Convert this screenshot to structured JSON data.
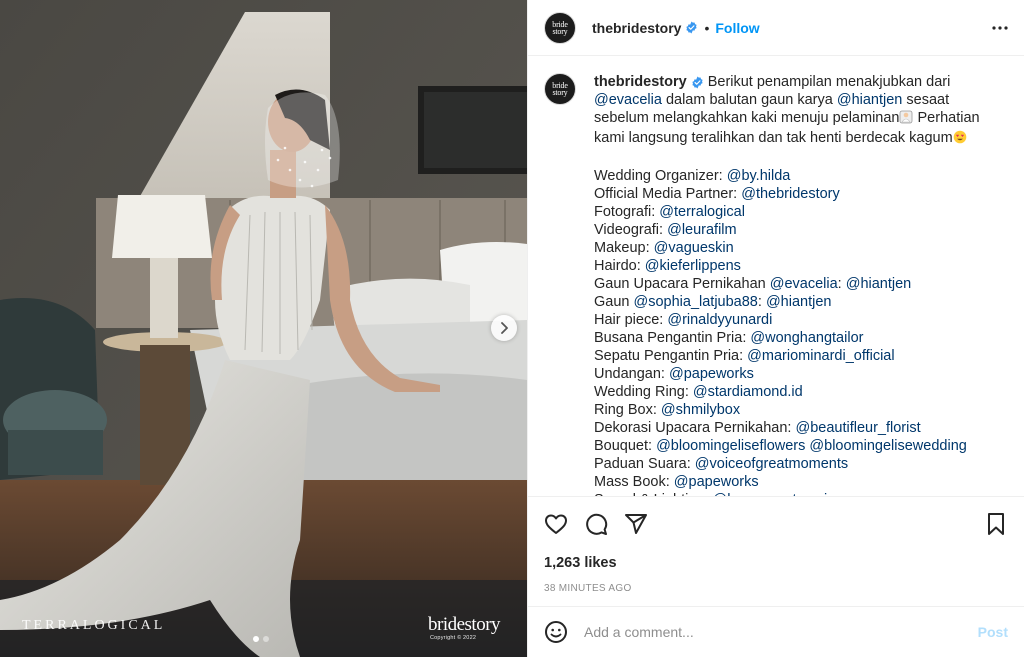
{
  "post": {
    "username": "thebridestory",
    "avatar_text": [
      "bride",
      "story"
    ],
    "follow_label": "Follow",
    "separator": "•"
  },
  "media": {
    "watermark_left": "TERRALOGICAL",
    "watermark_right_brand": "bridestory",
    "watermark_right_copyright": "Copyright © 2022",
    "carousel_count": 2,
    "carousel_active": 1
  },
  "caption": {
    "username": "thebridestory",
    "intro": [
      [
        {
          "t": "Berikut penampilan menakjubkan dari"
        }
      ],
      [
        {
          "m": "@evacelia"
        },
        {
          "t": " dalam balutan gaun karya "
        },
        {
          "m": "@hiantjen"
        },
        {
          "t": " sesaat"
        }
      ],
      [
        {
          "t": "sebelum melangkahkan kaki menuju pelaminan"
        },
        {
          "e": "bride-emoji"
        },
        {
          "t": " Perhatian"
        }
      ],
      [
        {
          "t": "kami langsung teralihkan dan tak henti berdecak kagum"
        },
        {
          "e": "heart-eyes-emoji"
        }
      ]
    ],
    "credits": [
      [
        {
          "t": "Wedding Organizer: "
        },
        {
          "m": "@by.hilda"
        }
      ],
      [
        {
          "t": "Official Media Partner: "
        },
        {
          "m": "@thebridestory"
        }
      ],
      [
        {
          "t": "Fotografi: "
        },
        {
          "m": "@terralogical"
        }
      ],
      [
        {
          "t": "Videografi: "
        },
        {
          "m": "@leurafilm"
        }
      ],
      [
        {
          "t": "Makeup: "
        },
        {
          "m": "@vagueskin"
        }
      ],
      [
        {
          "t": "Hairdo: "
        },
        {
          "m": "@kieferlippens"
        }
      ],
      [
        {
          "t": "Gaun Upacara Pernikahan "
        },
        {
          "m": "@evacelia"
        },
        {
          "t": ": "
        },
        {
          "m": "@hiantjen"
        }
      ],
      [
        {
          "t": "Gaun "
        },
        {
          "m": "@sophia_latjuba88"
        },
        {
          "t": ": "
        },
        {
          "m": "@hiantjen"
        }
      ],
      [
        {
          "t": "Hair piece: "
        },
        {
          "m": "@rinaldyyunardi"
        }
      ],
      [
        {
          "t": "Busana Pengantin Pria: "
        },
        {
          "m": "@wonghangtailor"
        }
      ],
      [
        {
          "t": "Sepatu Pengantin Pria: "
        },
        {
          "m": "@mariominardi_official"
        }
      ],
      [
        {
          "t": "Undangan: "
        },
        {
          "m": "@papeworks"
        }
      ],
      [
        {
          "t": "Wedding Ring: "
        },
        {
          "m": "@stardiamond.id"
        }
      ],
      [
        {
          "t": "Ring Box: "
        },
        {
          "m": "@shmilybox"
        }
      ],
      [
        {
          "t": "Dekorasi Upacara Pernikahan: "
        },
        {
          "m": "@beautifleur_florist"
        }
      ],
      [
        {
          "t": "Bouquet: "
        },
        {
          "m": "@bloomingeliseflowers"
        },
        {
          "t": " "
        },
        {
          "m": "@bloomingelisewedding"
        }
      ],
      [
        {
          "t": "Paduan Suara: "
        },
        {
          "m": "@voiceofgreatmoments"
        }
      ],
      [
        {
          "t": "Mass Book: "
        },
        {
          "m": "@papeworks"
        }
      ],
      [
        {
          "t": "Sound & Lighting: "
        },
        {
          "m": "@hearmeoutmusic"
        }
      ]
    ]
  },
  "engagement": {
    "likes": "1,263 likes",
    "time_ago": "38 MINUTES AGO"
  },
  "comment_box": {
    "placeholder": "Add a comment...",
    "post_label": "Post"
  },
  "colors": {
    "link": "#00376b",
    "follow": "#0095f6",
    "verified": "#3897f0",
    "post_disabled": "#b2dffc"
  }
}
